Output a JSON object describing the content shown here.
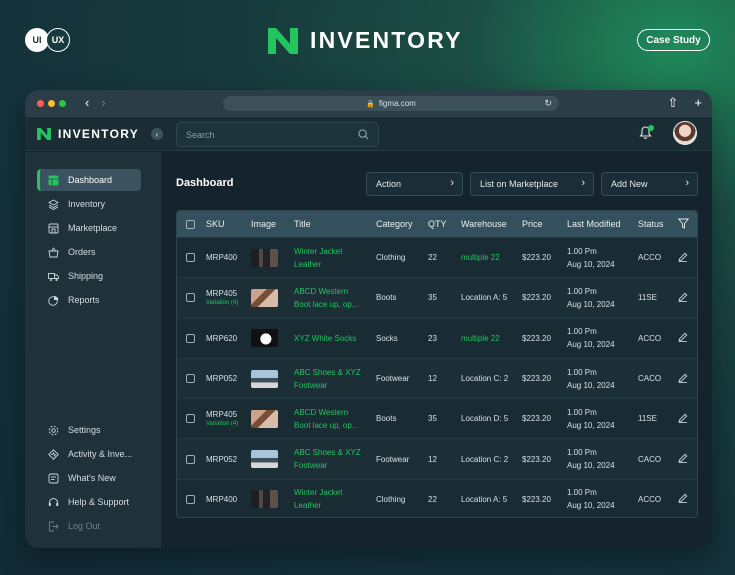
{
  "badge": {
    "ui": "UI",
    "ux": "UX"
  },
  "hero": {
    "title": "INVENTORY"
  },
  "case_study": "Case Study",
  "browser": {
    "url": "figma.com"
  },
  "app": {
    "brand": "INVENTORY",
    "search_placeholder": "Search"
  },
  "sidebar": {
    "items": [
      {
        "label": "Dashboard",
        "icon": "dashboard-icon",
        "active": true
      },
      {
        "label": "Inventory",
        "icon": "layers-icon"
      },
      {
        "label": "Marketplace",
        "icon": "store-icon"
      },
      {
        "label": "Orders",
        "icon": "basket-icon"
      },
      {
        "label": "Shipping",
        "icon": "truck-icon"
      },
      {
        "label": "Reports",
        "icon": "pie-chart-icon"
      }
    ],
    "bottom": [
      {
        "label": "Settings",
        "icon": "gear-icon"
      },
      {
        "label": "Activity & Inve...",
        "icon": "activity-icon"
      },
      {
        "label": "What's New",
        "icon": "news-icon"
      },
      {
        "label": "Help & Support",
        "icon": "headset-icon"
      },
      {
        "label": "Log Out",
        "icon": "logout-icon"
      }
    ]
  },
  "main": {
    "title": "Dashboard",
    "buttons": {
      "action": "Action",
      "list": "List on Marketplace",
      "add": "Add New"
    }
  },
  "table": {
    "headers": [
      "SKU",
      "Image",
      "Title",
      "Category",
      "QTY",
      "Warehouse",
      "Price",
      "Last Modified",
      "Status"
    ],
    "rows": [
      {
        "sku": "MRP400",
        "variation": "",
        "image": "jacket",
        "title1": "Winter Jacket",
        "title2": "Leather",
        "category": "Clothing",
        "qty": "22",
        "warehouse": "multiple 22",
        "warehouse_green": true,
        "price": "$223.20",
        "time": "1.00 Pm",
        "date": "Aug 10, 2024",
        "status": "ACCO"
      },
      {
        "sku": "MRP405",
        "variation": "Variation (4)",
        "image": "boot",
        "title1": "ABCD Western",
        "title2": "Boot lace up, op...",
        "category": "Boots",
        "qty": "35",
        "warehouse": "Location A: 5",
        "warehouse_green": false,
        "price": "$223.20",
        "time": "1.00 Pm",
        "date": "Aug 10, 2024",
        "status": "11SE"
      },
      {
        "sku": "MRP620",
        "variation": "",
        "image": "socks",
        "title1": "XYZ White Socks",
        "title2": "",
        "category": "Socks",
        "qty": "23",
        "warehouse": "multiple 22",
        "warehouse_green": true,
        "price": "$223.20",
        "time": "1.00 Pm",
        "date": "Aug 10, 2024",
        "status": "ACCO"
      },
      {
        "sku": "MRP052",
        "variation": "",
        "image": "shoes",
        "title1": "ABC Shoes & XYZ",
        "title2": "Footwear",
        "category": "Footwear",
        "qty": "12",
        "warehouse": "Location C: 2",
        "warehouse_green": false,
        "price": "$223.20",
        "time": "1.00 Pm",
        "date": "Aug 10, 2024",
        "status": "CACO"
      },
      {
        "sku": "MRP405",
        "variation": "Variation (4)",
        "image": "boot",
        "title1": "ABCD Western",
        "title2": "Boot lace up, op...",
        "category": "Boots",
        "qty": "35",
        "warehouse": "Location D: 5",
        "warehouse_green": false,
        "price": "$223.20",
        "time": "1.00 Pm",
        "date": "Aug 10, 2024",
        "status": "11SE"
      },
      {
        "sku": "MRP052",
        "variation": "",
        "image": "shoes",
        "title1": "ABC Shoes & XYZ",
        "title2": "Footwear",
        "category": "Footwear",
        "qty": "12",
        "warehouse": "Location C: 2",
        "warehouse_green": false,
        "price": "$223.20",
        "time": "1.00 Pm",
        "date": "Aug 10, 2024",
        "status": "CACO"
      },
      {
        "sku": "MRP400",
        "variation": "",
        "image": "jacket",
        "title1": "Winter Jacket",
        "title2": "Leather",
        "category": "Clothing",
        "qty": "22",
        "warehouse": "Location A: 5",
        "warehouse_green": false,
        "price": "$223.20",
        "time": "1.00 Pm",
        "date": "Aug 10, 2024",
        "status": "ACCO"
      }
    ]
  },
  "colors": {
    "accent": "#22c55e",
    "bg": "#15242c",
    "sidebar": "#1f3139",
    "header_row": "#35505d"
  }
}
